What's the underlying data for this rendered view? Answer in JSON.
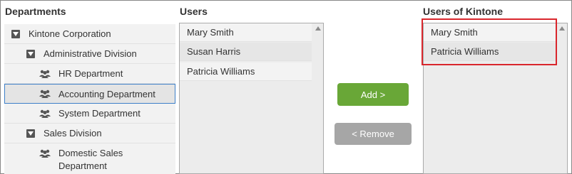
{
  "headings": {
    "departments": "Departments",
    "users": "Users",
    "kintone_users": "Users of Kintone"
  },
  "departments": [
    {
      "label": "Kintone Corporation",
      "level": 0,
      "icon": "collapse-toggle-icon"
    },
    {
      "label": "Administrative Division",
      "level": 1,
      "icon": "collapse-toggle-icon"
    },
    {
      "label": "HR Department",
      "level": 2,
      "icon": "group-icon"
    },
    {
      "label": "Accounting Department",
      "level": 2,
      "icon": "group-icon",
      "selected": true
    },
    {
      "label": "System Department",
      "level": 2,
      "icon": "group-icon"
    },
    {
      "label": "Sales Division",
      "level": 1,
      "icon": "collapse-toggle-icon"
    },
    {
      "label_line1": "Domestic Sales",
      "label_line2": "Department",
      "level": 2,
      "icon": "group-icon"
    }
  ],
  "users": [
    "Mary Smith",
    "Susan Harris",
    "Patricia Williams"
  ],
  "kintone_users": [
    "Mary Smith",
    "Patricia Williams"
  ],
  "buttons": {
    "add": "Add >",
    "remove": "< Remove"
  },
  "colors": {
    "add_button": "#69a737",
    "remove_button": "#a6a6a6",
    "selection_border": "#3d7fc8",
    "highlight_border": "#d9262c"
  }
}
